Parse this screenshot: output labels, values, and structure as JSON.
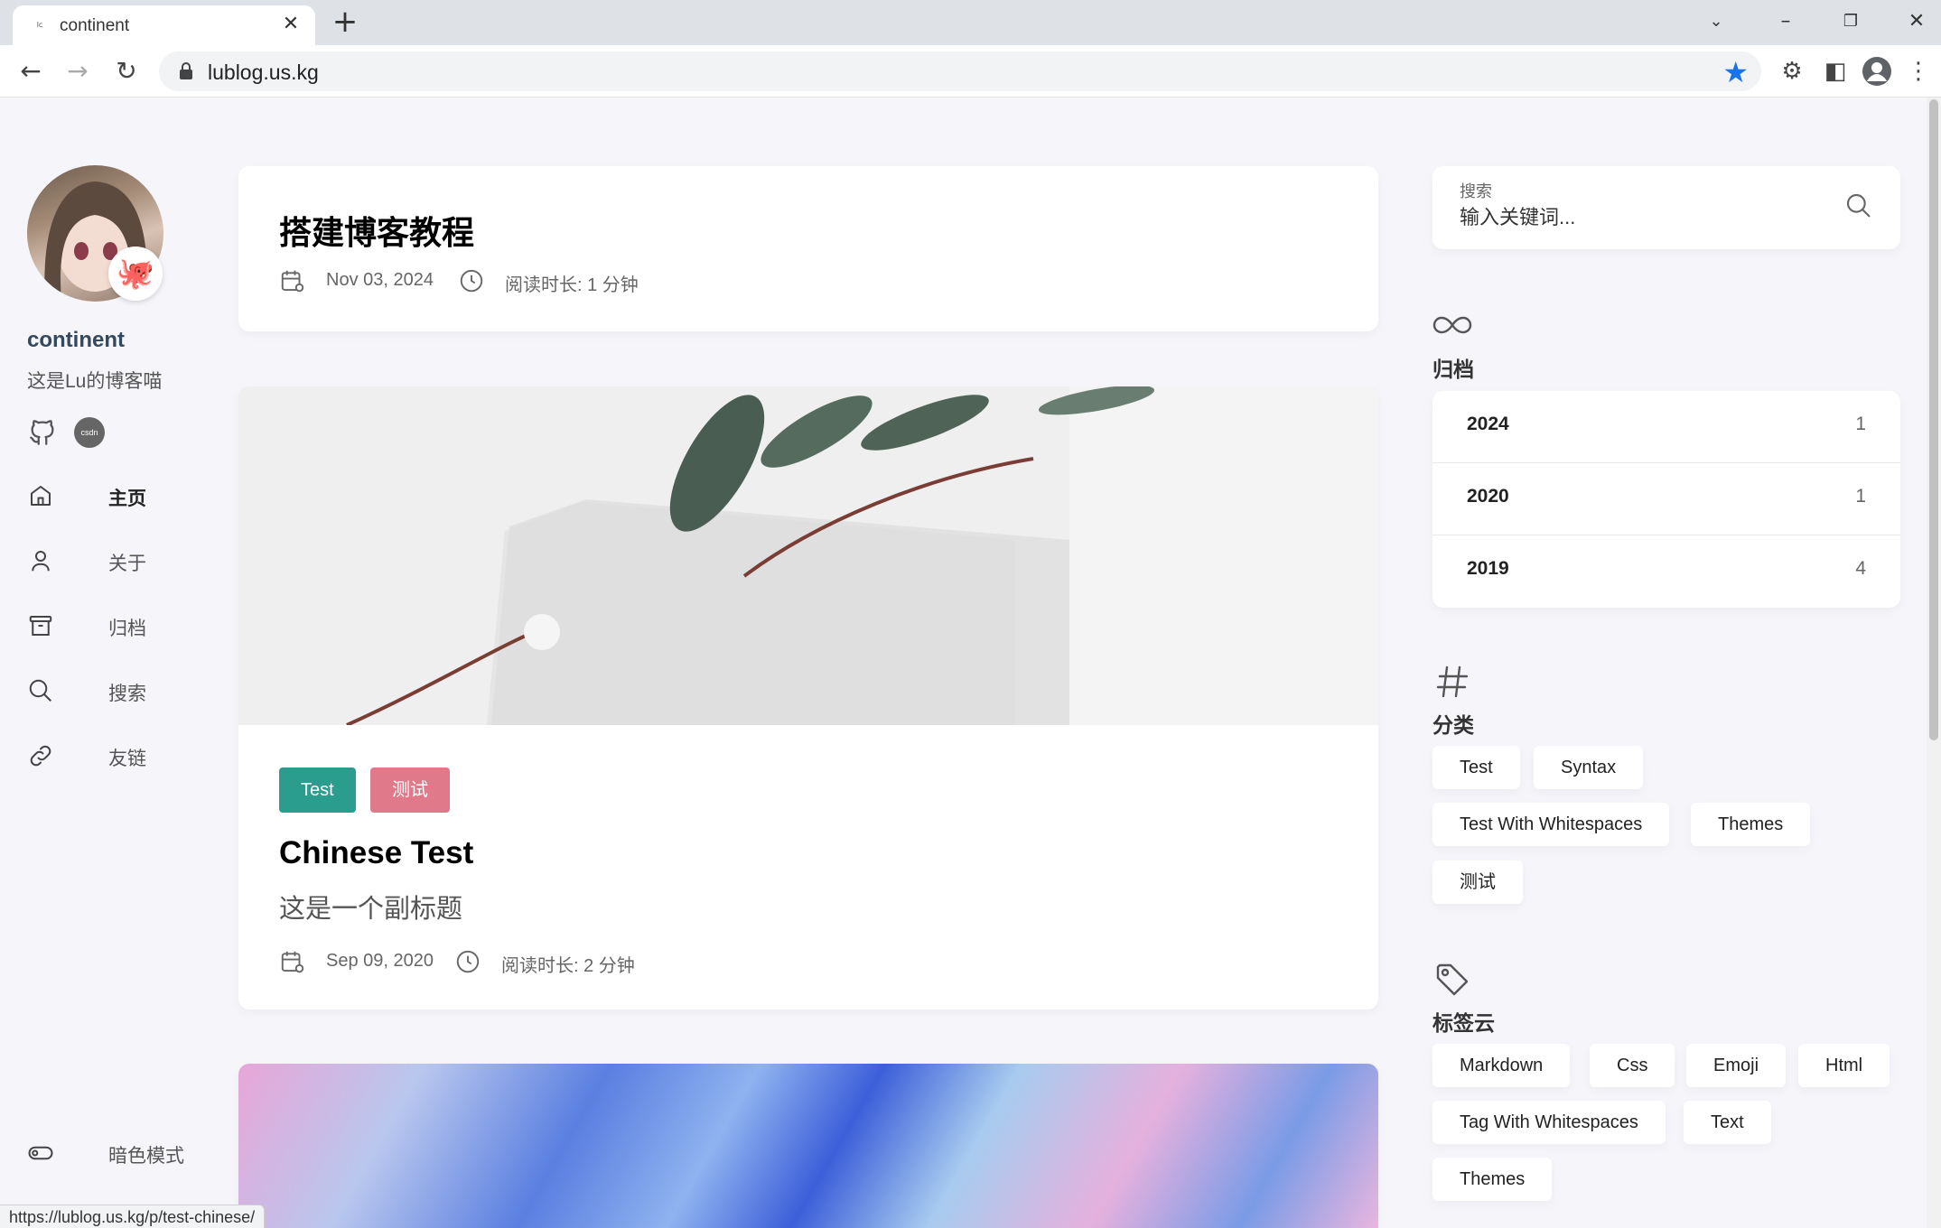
{
  "browser": {
    "tab_title": "continent",
    "tab_favicon": "lc",
    "url": "lublog.us.kg",
    "status_url": "https://lublog.us.kg/p/test-chinese/"
  },
  "sidebar": {
    "site_name": "continent",
    "site_desc": "这是Lu的博客喵",
    "avatar_emoji": "🐙",
    "csdn_label": "csdn",
    "nav": [
      {
        "label": "主页",
        "icon": "home-icon"
      },
      {
        "label": "关于",
        "icon": "user-icon"
      },
      {
        "label": "归档",
        "icon": "archive-icon"
      },
      {
        "label": "搜索",
        "icon": "search-icon"
      },
      {
        "label": "友链",
        "icon": "link-icon"
      }
    ],
    "dark_mode_label": "暗色模式"
  },
  "posts": [
    {
      "title": "搭建博客教程",
      "date": "Nov 03, 2024",
      "reading_time": "阅读时长: 1 分钟"
    },
    {
      "categories": [
        "Test",
        "测试"
      ],
      "category_colors": [
        "#2a9d8f",
        "#e07a8b"
      ],
      "title": "Chinese Test",
      "subtitle": "这是一个副标题",
      "date": "Sep 09, 2020",
      "reading_time": "阅读时长: 2 分钟"
    }
  ],
  "search": {
    "label": "搜索",
    "placeholder": "输入关键词..."
  },
  "archives": {
    "title": "归档",
    "items": [
      {
        "year": "2024",
        "count": "1"
      },
      {
        "year": "2020",
        "count": "1"
      },
      {
        "year": "2019",
        "count": "4"
      }
    ]
  },
  "categories": {
    "title": "分类",
    "items": [
      "Test",
      "Syntax",
      "Test With Whitespaces",
      "Themes",
      "测试"
    ]
  },
  "tag_cloud": {
    "title": "标签云",
    "items": [
      "Markdown",
      "Css",
      "Emoji",
      "Html",
      "Tag With Whitespaces",
      "Text",
      "Themes"
    ]
  },
  "colors": {
    "accent": "#34495e",
    "bookmark_star": "#1a73e8",
    "page_bg": "#f5f5fa"
  }
}
